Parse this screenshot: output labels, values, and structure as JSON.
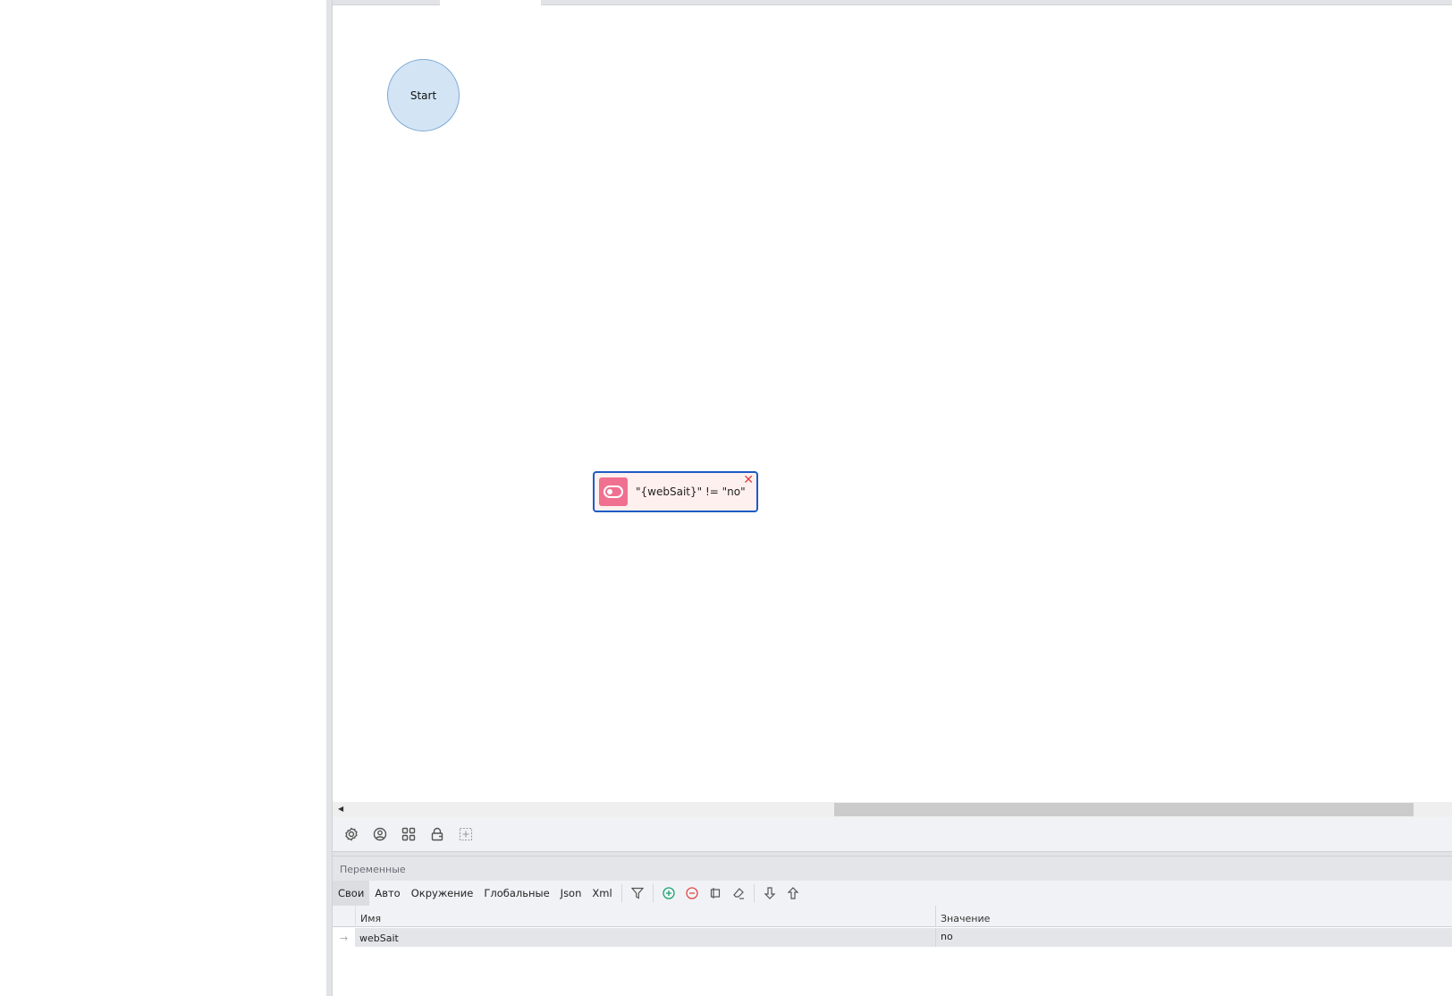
{
  "canvas": {
    "start_node": "Start",
    "condition_node": {
      "expression": "\"{webSait}\" != \"no\"",
      "icon": "toggle-icon",
      "delete": "✕"
    }
  },
  "toolbar": {
    "icons": [
      "gear-icon",
      "user-circle-icon",
      "grid-icon",
      "lock-icon",
      "add-frame-icon"
    ]
  },
  "variables": {
    "title": "Переменные",
    "tabs": [
      "Свои",
      "Авто",
      "Окружение",
      "Глобальные",
      "Json",
      "Xml"
    ],
    "active_tab": "Свои",
    "columns": [
      "Имя",
      "Значение"
    ],
    "rows": [
      {
        "marker": "→",
        "name": "webSait",
        "value": "no"
      }
    ]
  }
}
